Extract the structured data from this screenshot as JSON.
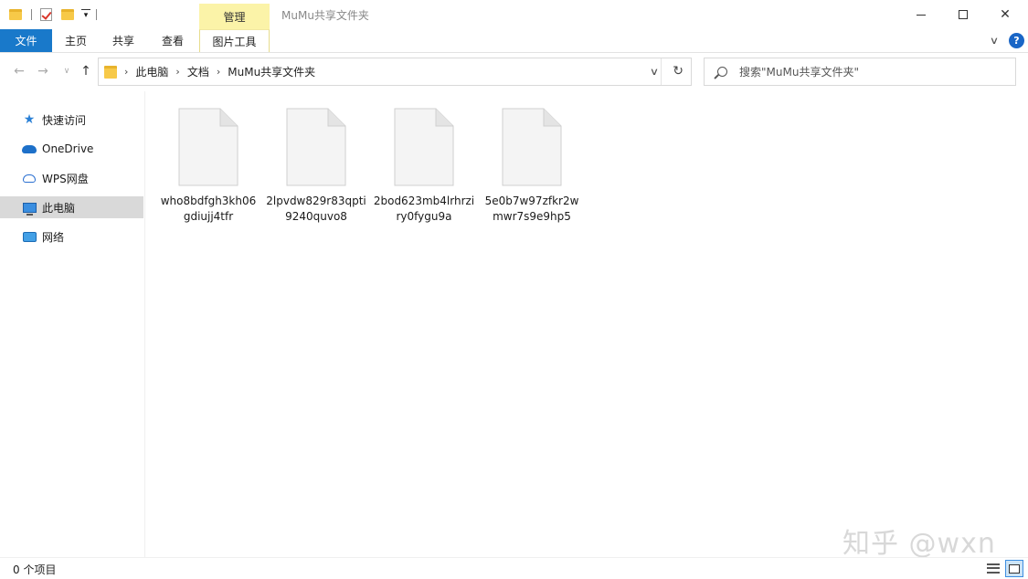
{
  "window": {
    "title": "MuMu共享文件夹",
    "context_tab_group": "管理"
  },
  "ribbon": {
    "tabs": [
      "文件",
      "主页",
      "共享",
      "查看"
    ],
    "context_tab": "图片工具",
    "accent_color": "#1979ca",
    "help_label": "?"
  },
  "address": {
    "crumbs": [
      "此电脑",
      "文档",
      "MuMu共享文件夹"
    ],
    "separator": "›"
  },
  "search": {
    "placeholder": "搜索\"MuMu共享文件夹\""
  },
  "sidebar": {
    "items": [
      {
        "label": "快速访问",
        "icon": "star-icon"
      },
      {
        "label": "OneDrive",
        "icon": "cloud-icon"
      },
      {
        "label": "WPS网盘",
        "icon": "wps-cloud-icon"
      },
      {
        "label": "此电脑",
        "icon": "computer-icon",
        "selected": true
      },
      {
        "label": "网络",
        "icon": "network-icon"
      }
    ]
  },
  "files": [
    {
      "name": "who8bdfgh3kh06gdiujj4tfr"
    },
    {
      "name": "2lpvdw829r83qpti9240quvo8"
    },
    {
      "name": "2bod623mb4lrhrziry0fygu9a"
    },
    {
      "name": "5e0b7w97zfkr2wmwr7s9e9hp5"
    }
  ],
  "status": {
    "item_count": "0 个项目"
  },
  "watermark": "知乎 @wxn"
}
